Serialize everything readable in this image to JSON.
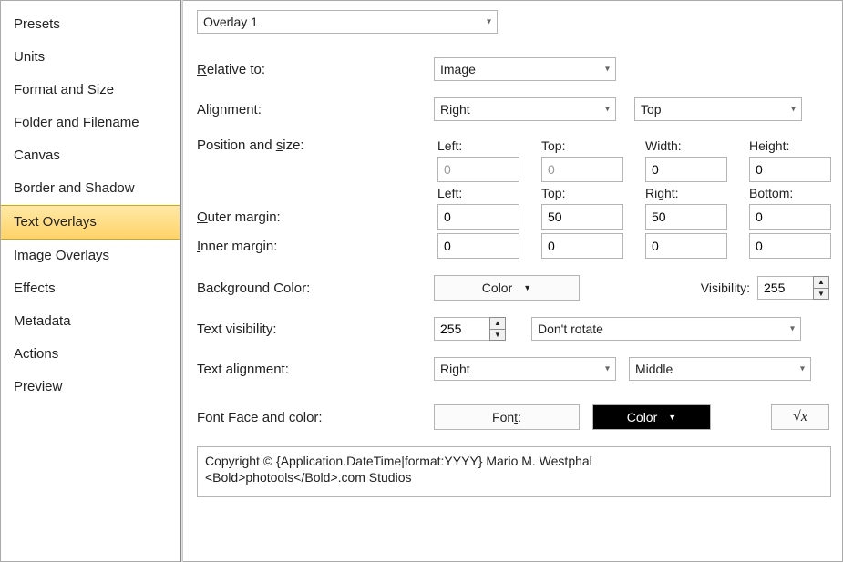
{
  "sidebar": {
    "selectedIndex": 6,
    "items": [
      "Presets",
      "Units",
      "Format and Size",
      "Folder and Filename",
      "Canvas",
      "Border and Shadow",
      "Text Overlays",
      "Image Overlays",
      "Effects",
      "Metadata",
      "Actions",
      "Preview"
    ]
  },
  "overlay_select": "Overlay 1",
  "labels": {
    "relative_to": "elative to:",
    "relative_to_u": "R",
    "alignment": "Alignment:",
    "position_size_pre": "Position and ",
    "position_size_u": "s",
    "position_size_post": "ize:",
    "outer_margin_u": "O",
    "outer_margin": "uter margin:",
    "inner_margin_u": "I",
    "inner_margin": "nner margin:",
    "background_color": "Background Color:",
    "text_visibility": "Text visibility:",
    "text_alignment": "Text alignment:",
    "font_face_color": "Font Face and color:",
    "visibility": "Visibility:",
    "font_btn_pre": "Fon",
    "font_btn_u": "t",
    "font_btn_post": ":",
    "color_btn": "Color",
    "color_btn2": "Color"
  },
  "headers": {
    "left": "Left:",
    "top": "Top:",
    "width": "Width:",
    "height": "Height:",
    "right": "Right:",
    "bottom": "Bottom:"
  },
  "relative_to": "Image",
  "align_h": "Right",
  "align_v": "Top",
  "pos": {
    "left": "0",
    "top": "0",
    "width": "0",
    "height": "0"
  },
  "outer": {
    "left": "0",
    "top": "50",
    "right": "50",
    "bottom": "0"
  },
  "inner": {
    "left": "0",
    "top": "0",
    "right": "0",
    "bottom": "0"
  },
  "bg_visibility": "255",
  "text_visibility": "255",
  "rotate": "Don't rotate",
  "text_align_h": "Right",
  "text_align_v": "Middle",
  "text_content": "Copyright © {Application.DateTime|format:YYYY} Mario M. Westphal\n<Bold>photools</Bold>.com Studios"
}
